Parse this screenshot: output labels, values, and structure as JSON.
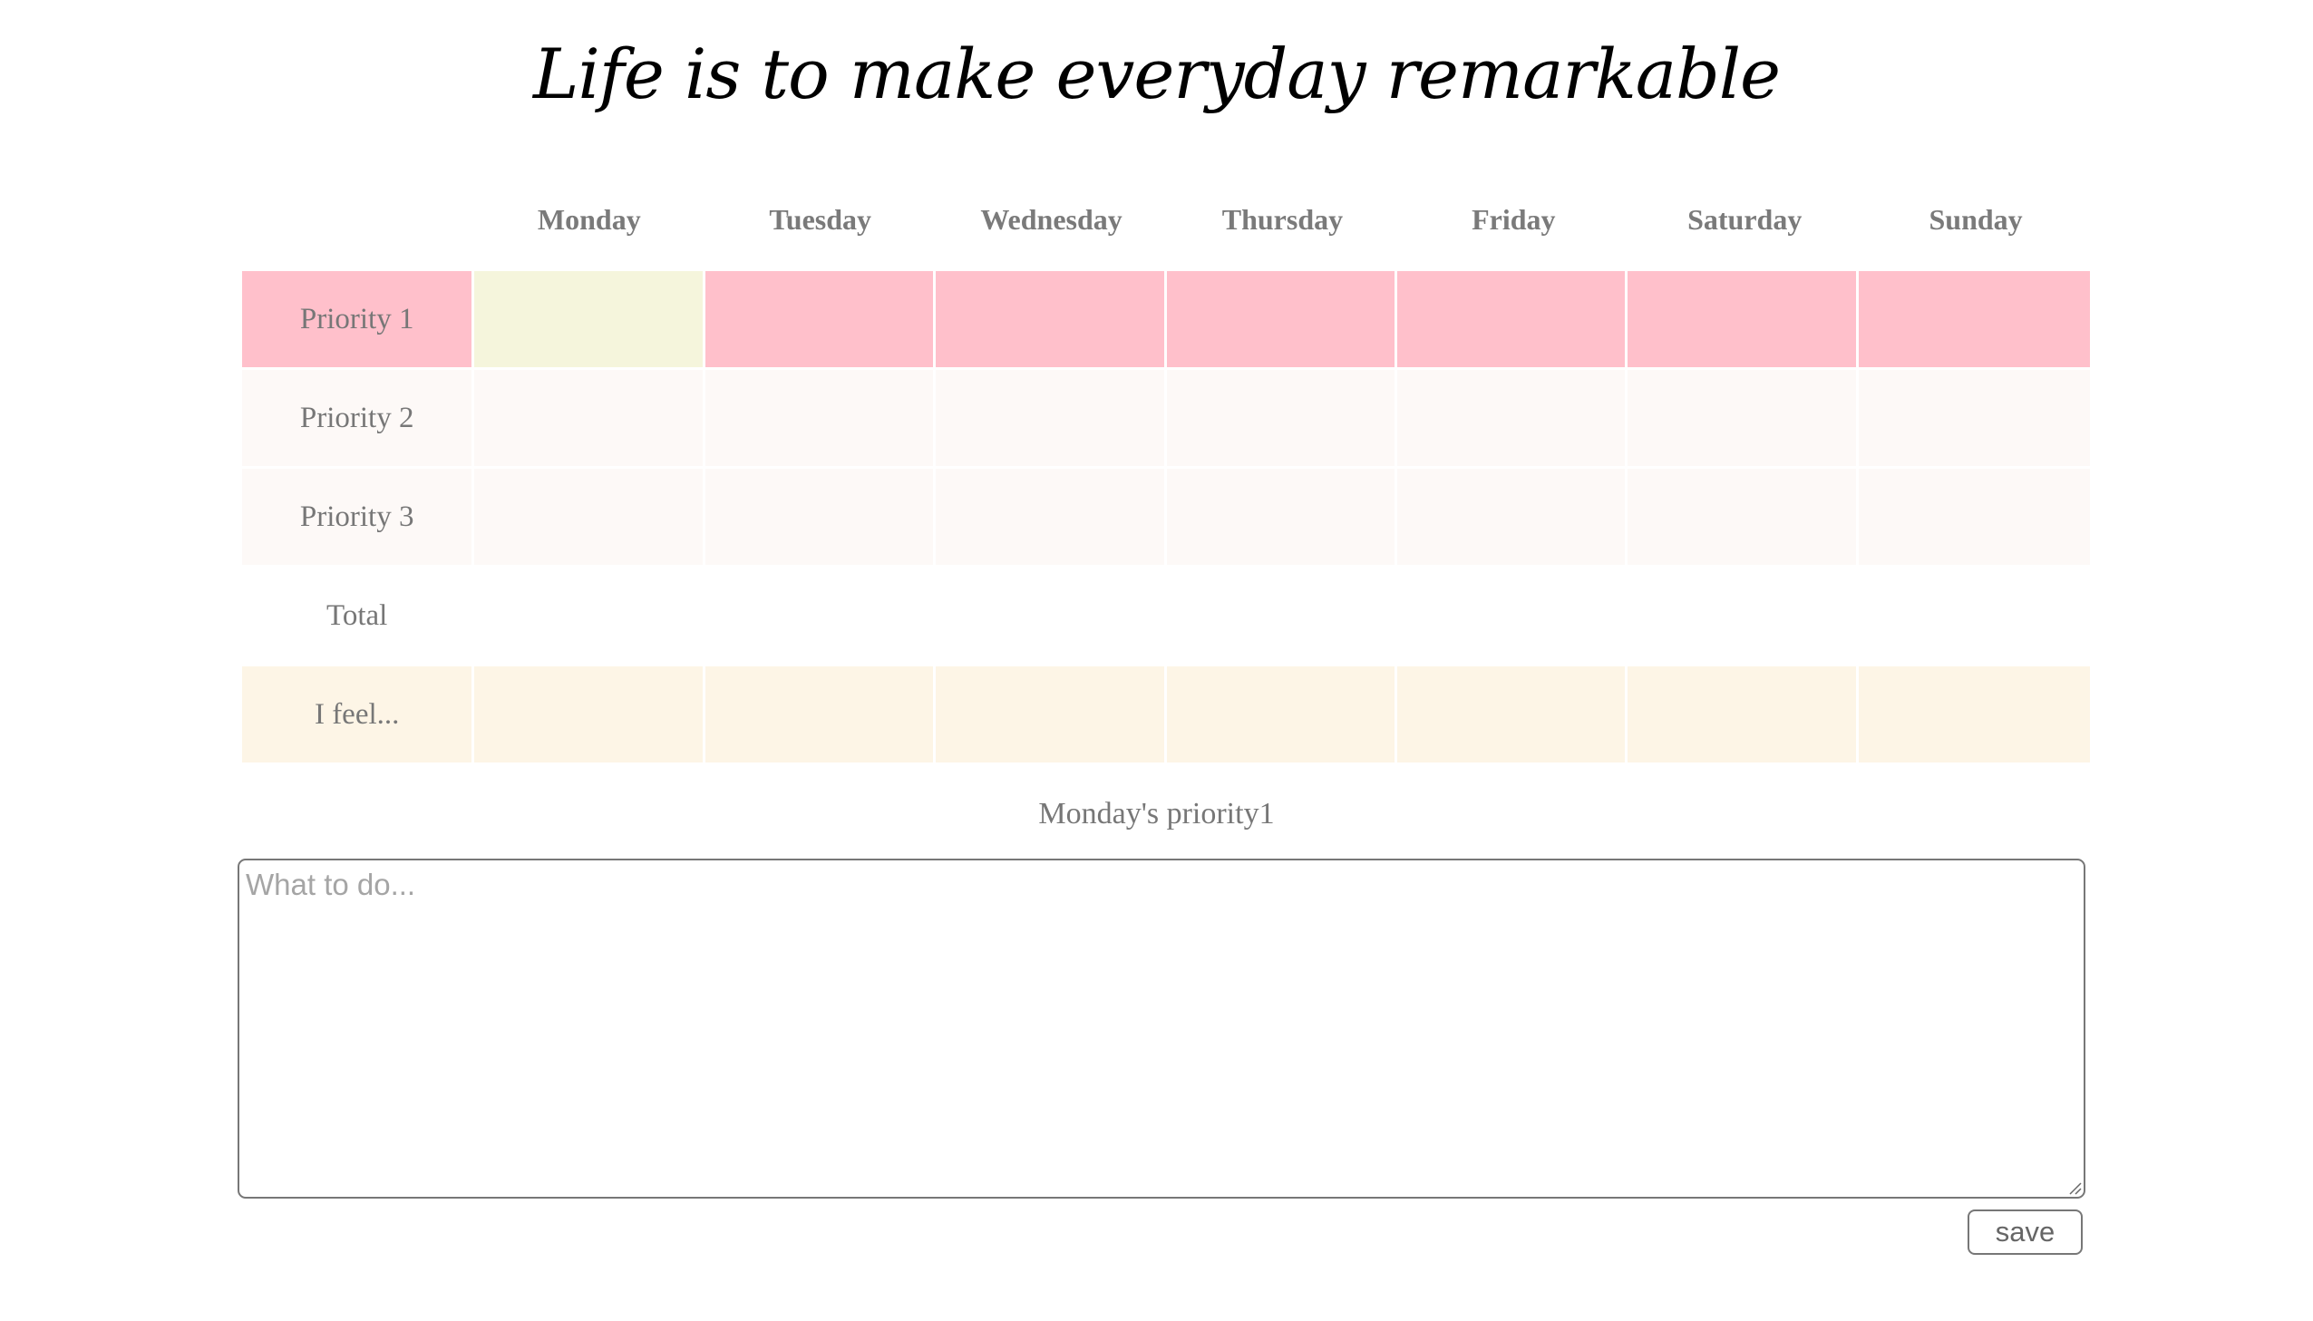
{
  "title": "Life is to make everyday remarkable",
  "days": [
    "Monday",
    "Tuesday",
    "Wednesday",
    "Thursday",
    "Friday",
    "Saturday",
    "Sunday"
  ],
  "rows": [
    {
      "label": "Priority 1",
      "cells": [
        "",
        "",
        "",
        "",
        "",
        "",
        ""
      ]
    },
    {
      "label": "Priority 2",
      "cells": [
        "",
        "",
        "",
        "",
        "",
        "",
        ""
      ]
    },
    {
      "label": "Priority 3",
      "cells": [
        "",
        "",
        "",
        "",
        "",
        "",
        ""
      ]
    },
    {
      "label": "Total",
      "cells": [
        "",
        "",
        "",
        "",
        "",
        "",
        ""
      ]
    },
    {
      "label": "I feel...",
      "cells": [
        "",
        "",
        "",
        "",
        "",
        "",
        ""
      ]
    }
  ],
  "selected": {
    "label": "Monday's priority1",
    "day": "Monday",
    "row": "Priority 1"
  },
  "editor": {
    "value": "",
    "placeholder": "What to do..."
  },
  "save_label": "save",
  "colors": {
    "priority1_row": "#ffc0cb",
    "selected_cell": "#f5f5dc",
    "priority_rows": "#fdf9f7",
    "feel_row": "#fdf5e6",
    "text": "#777777"
  }
}
